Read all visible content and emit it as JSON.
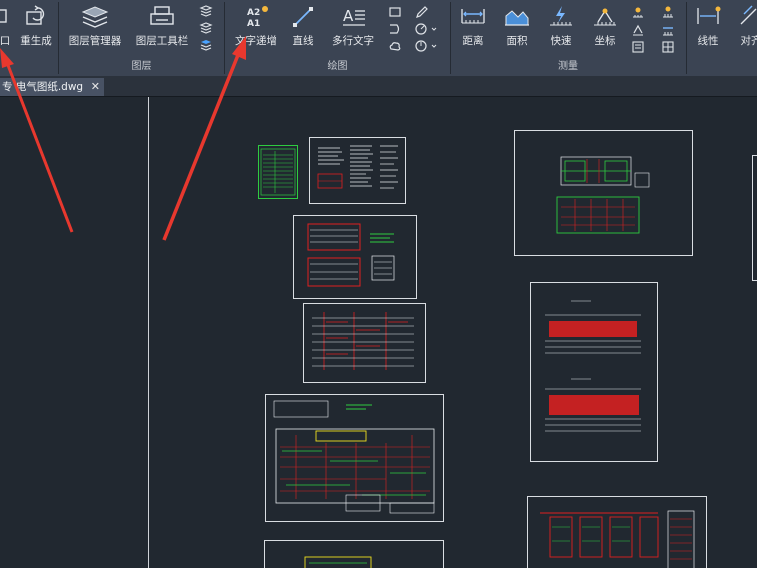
{
  "ribbon": {
    "left_partial": {
      "label": "口"
    },
    "regen": {
      "label": "重生成"
    },
    "layer_group": {
      "label": "图层",
      "layer_manager": "图层管理器",
      "layer_toolbar": "图层工具栏"
    },
    "draw_group": {
      "label": "绘图",
      "text_increment": "文字递增",
      "text_increment_glyph": "A2\nA1",
      "line": "直线",
      "mtext": "多行文字"
    },
    "measure_group": {
      "label": "测量",
      "distance": "距离",
      "area": "面积",
      "quick": "快速",
      "coordinate": "坐标"
    },
    "dim_group": {
      "linear": "线性",
      "aligned": "对齐"
    }
  },
  "file_tab": {
    "title": "电气图纸.dwg",
    "prefix_glyph": "专",
    "close": "✕"
  },
  "colors": {
    "ribbon_bg": "#3b4453",
    "canvas_bg": "#212830",
    "accent_red": "#e8382e",
    "drawing_green": "#2ecc40",
    "drawing_red": "#e02020"
  }
}
